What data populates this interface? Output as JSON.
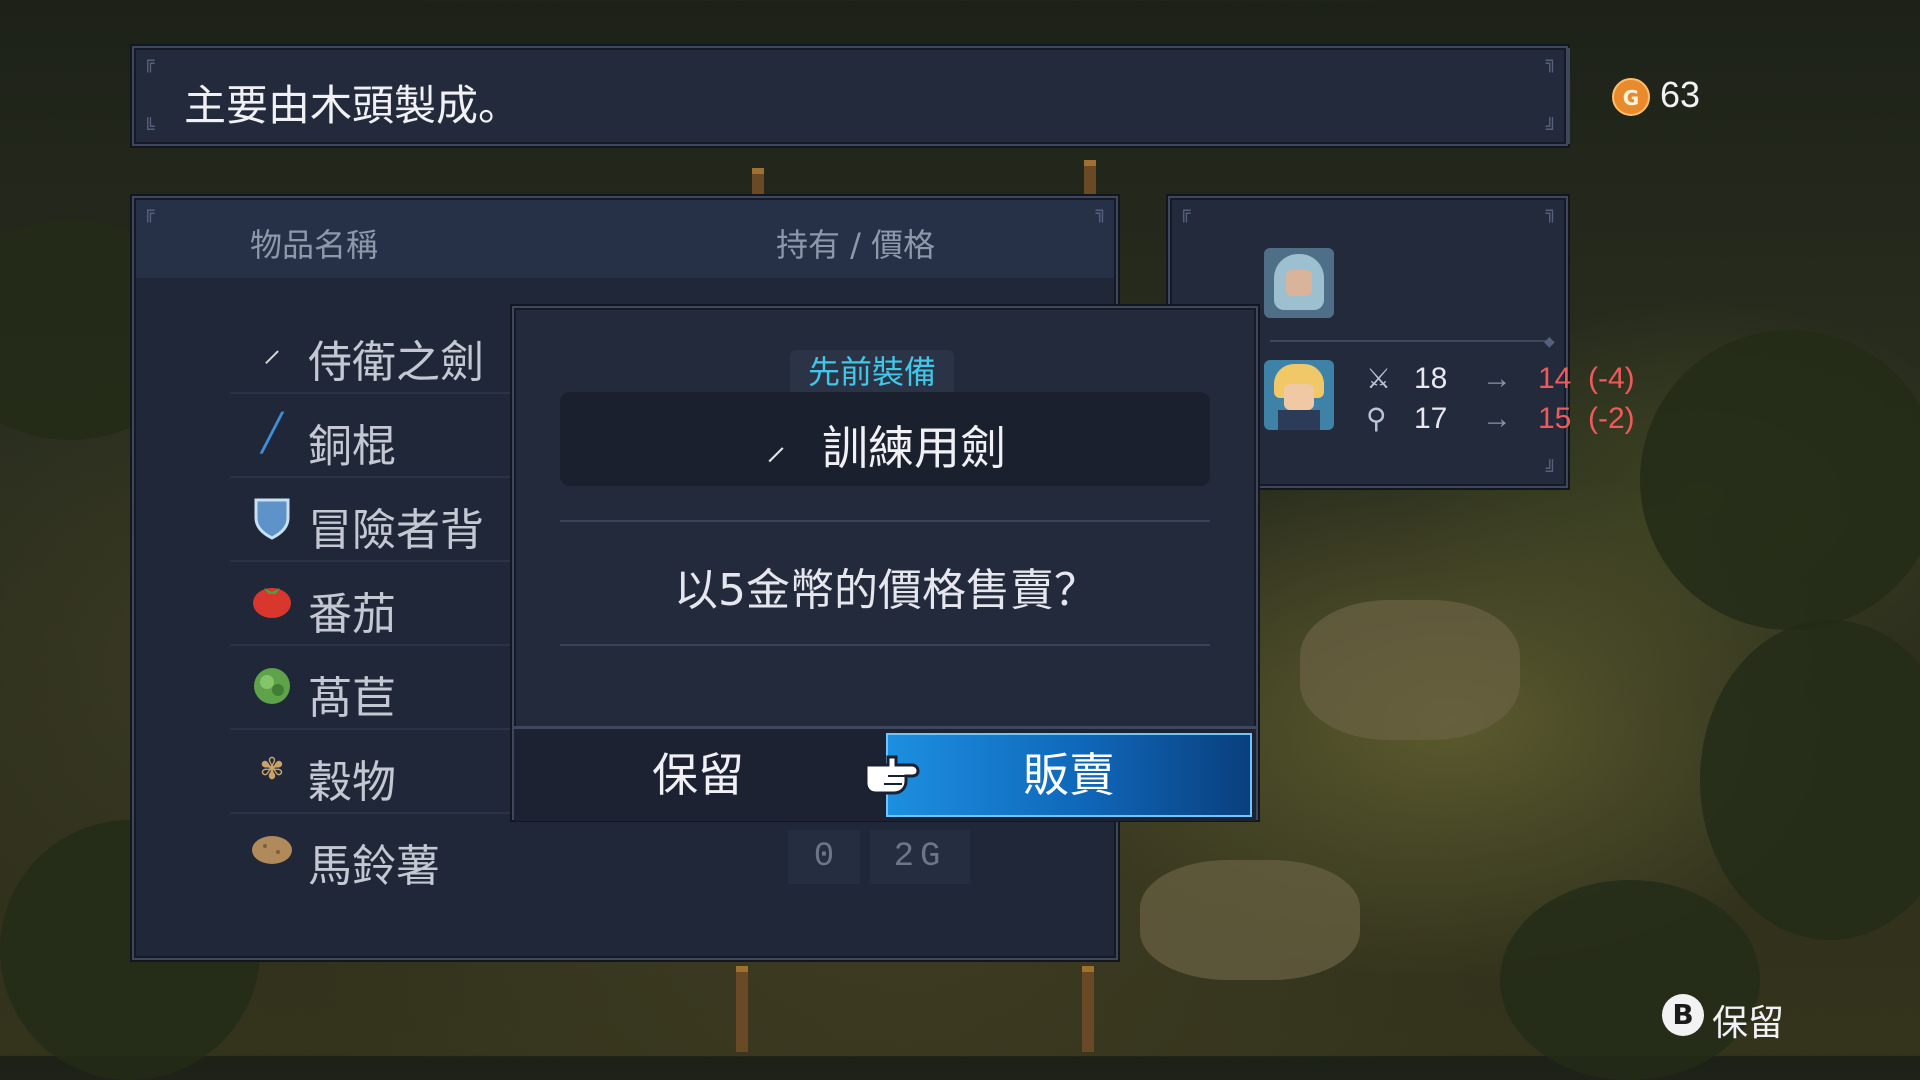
{
  "description": {
    "text": "主要由木頭製成。"
  },
  "currency": {
    "icon": "G",
    "amount": "63"
  },
  "item_list": {
    "header_name": "物品名稱",
    "header_price": "持有 / 價格",
    "items": [
      {
        "name": "侍衛之劍",
        "icon": "sword-icon"
      },
      {
        "name": "銅棍",
        "icon": "staff-icon"
      },
      {
        "name": "冒險者背",
        "icon": "shield-icon"
      },
      {
        "name": "番茄",
        "icon": "tomato-icon"
      },
      {
        "name": "萵苣",
        "icon": "lettuce-icon"
      },
      {
        "name": "穀物",
        "icon": "grain-icon"
      },
      {
        "name": "馬鈴薯",
        "icon": "potato-icon",
        "owned": "0",
        "price": "2G"
      }
    ]
  },
  "compare": {
    "stats": [
      {
        "icon": "attack-icon",
        "old": "18",
        "arrow": "→",
        "new": "14",
        "diff": "(-4)"
      },
      {
        "icon": "defense-icon",
        "old": "17",
        "arrow": "→",
        "new": "15",
        "diff": "(-2)"
      }
    ]
  },
  "dialog": {
    "previous_label": "先前裝備",
    "previous_item": "訓練用劍",
    "question": "以5金幣的價格售賣？",
    "keep_label": "保留",
    "sell_label": "販賣"
  },
  "hint": {
    "button": "B",
    "label": "保留"
  },
  "colors": {
    "accent": "#1d8fe0",
    "label_cyan": "#41c6e8",
    "negative": "#ef5a5a",
    "coin": "#e98a2c"
  }
}
